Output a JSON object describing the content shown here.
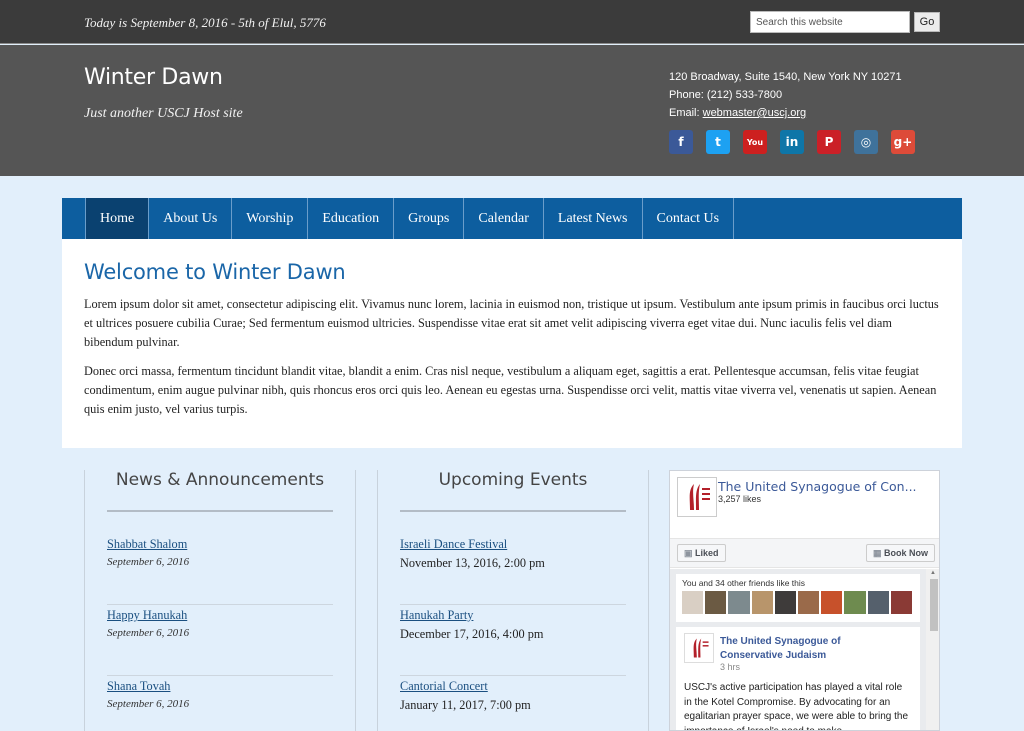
{
  "topbar": {
    "date_text": "Today is September 8, 2016 - 5th of Elul, 5776",
    "search_placeholder": "Search this website",
    "go_label": "Go"
  },
  "header": {
    "site_title": "Winter Dawn",
    "tagline": "Just another USCJ Host site",
    "address": "120 Broadway, Suite 1540, New York NY 10271",
    "phone": "Phone: (212) 533-7800",
    "email_label": "Email:",
    "email": "webmaster@uscj.org",
    "social": [
      {
        "name": "facebook-icon",
        "glyph": "f",
        "color": "#3b5998"
      },
      {
        "name": "twitter-icon",
        "glyph": "t",
        "color": "#1da1f2"
      },
      {
        "name": "youtube-icon",
        "glyph": "You",
        "color": "#cd201f"
      },
      {
        "name": "linkedin-icon",
        "glyph": "in",
        "color": "#0e76a8"
      },
      {
        "name": "pinterest-icon",
        "glyph": "P",
        "color": "#cb2027"
      },
      {
        "name": "instagram-icon",
        "glyph": "◎",
        "color": "#3f729b"
      },
      {
        "name": "googleplus-icon",
        "glyph": "g+",
        "color": "#dd4b39"
      }
    ]
  },
  "nav": {
    "items": [
      "Home",
      "About Us",
      "Worship",
      "Education",
      "Groups",
      "Calendar",
      "Latest News",
      "Contact Us"
    ],
    "active": "Home"
  },
  "main": {
    "heading": "Welcome to Winter Dawn",
    "paragraphs": [
      "Lorem ipsum dolor sit amet, consectetur adipiscing elit. Vivamus nunc lorem, lacinia in euismod non, tristique ut ipsum. Vestibulum ante ipsum primis in faucibus orci luctus et ultrices posuere cubilia Curae; Sed fermentum euismod ultricies. Suspendisse vitae erat sit amet velit adipiscing viverra eget vitae dui. Nunc iaculis felis vel diam bibendum pulvinar.",
      "Donec orci massa, fermentum tincidunt blandit vitae, blandit a enim. Cras nisl neque, vestibulum a aliquam eget, sagittis a erat. Pellentesque accumsan, felis vitae feugiat condimentum, enim augue pulvinar nibh, quis rhoncus eros orci quis leo. Aenean eu egestas urna. Suspendisse orci velit, mattis vitae viverra vel, venenatis ut sapien. Aenean quis enim justo, vel varius turpis."
    ]
  },
  "news": {
    "title": "News & Announcements",
    "items": [
      {
        "title": "Shabbat Shalom",
        "date": "September 6, 2016"
      },
      {
        "title": "Happy Hanukah",
        "date": "September 6, 2016"
      },
      {
        "title": "Shana Tovah",
        "date": "September 6, 2016"
      }
    ]
  },
  "events": {
    "title": "Upcoming Events",
    "items": [
      {
        "title": "Israeli Dance Festival",
        "when": "November 13, 2016, 2:00 pm"
      },
      {
        "title": "Hanukah Party",
        "when": "December 17, 2016, 4:00 pm"
      },
      {
        "title": "Cantorial Concert",
        "when": "January 11, 2017, 7:00 pm"
      }
    ]
  },
  "facebook": {
    "page_name": "The United Synagogue of Con...",
    "likes": "3,257 likes",
    "liked_label": "Liked",
    "book_label": "Book Now",
    "friends_text": "You and 34 other friends like this",
    "post_title_line1": "The United Synagogue of",
    "post_title_line2": "Conservative Judaism",
    "post_time": "3 hrs",
    "post_text": "USCJ's active participation has played a vital role in the Kotel Compromise. By advocating for an egalitarian prayer space, we were able to bring the importance of Israel's need to make"
  }
}
